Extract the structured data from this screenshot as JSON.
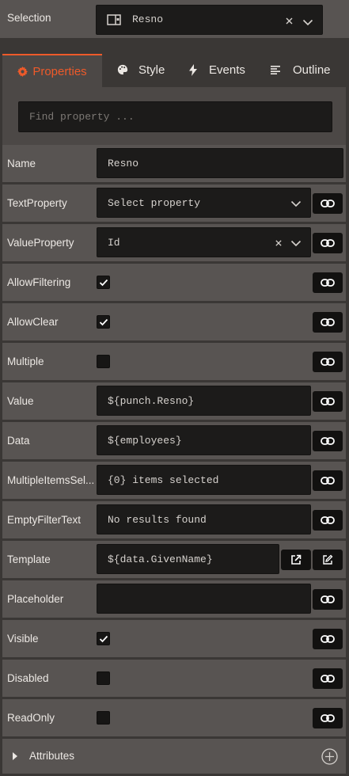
{
  "selection": {
    "label": "Selection",
    "value": "Resno"
  },
  "tabs": [
    {
      "label": "Properties",
      "active": true
    },
    {
      "label": "Style",
      "active": false
    },
    {
      "label": "Events",
      "active": false
    },
    {
      "label": "Outline",
      "active": false
    }
  ],
  "search": {
    "placeholder": "Find property ..."
  },
  "properties": {
    "name": {
      "label": "Name",
      "value": "Resno"
    },
    "text_property": {
      "label": "TextProperty",
      "value": "Select property"
    },
    "value_property": {
      "label": "ValueProperty",
      "value": "Id"
    },
    "allow_filtering": {
      "label": "AllowFiltering",
      "checked": true
    },
    "allow_clear": {
      "label": "AllowClear",
      "checked": true
    },
    "multiple": {
      "label": "Multiple",
      "checked": false
    },
    "value": {
      "label": "Value",
      "value": "${punch.Resno}"
    },
    "data": {
      "label": "Data",
      "value": "${employees}"
    },
    "multiple_items_selected": {
      "label": "MultipleItemsSel...",
      "value": "{0} items selected"
    },
    "empty_filter_text": {
      "label": "EmptyFilterText",
      "value": "No results found"
    },
    "template": {
      "label": "Template",
      "value": "${data.GivenName}"
    },
    "placeholder": {
      "label": "Placeholder",
      "value": ""
    },
    "visible": {
      "label": "Visible",
      "checked": true
    },
    "disabled": {
      "label": "Disabled",
      "checked": false
    },
    "read_only": {
      "label": "ReadOnly",
      "checked": false
    }
  },
  "attributes": {
    "label": "Attributes"
  },
  "colors": {
    "accent": "#ee5a2a",
    "row_bg": "#585452",
    "field_bg": "#1c1b1a",
    "panel_bg": "#3a3735"
  }
}
